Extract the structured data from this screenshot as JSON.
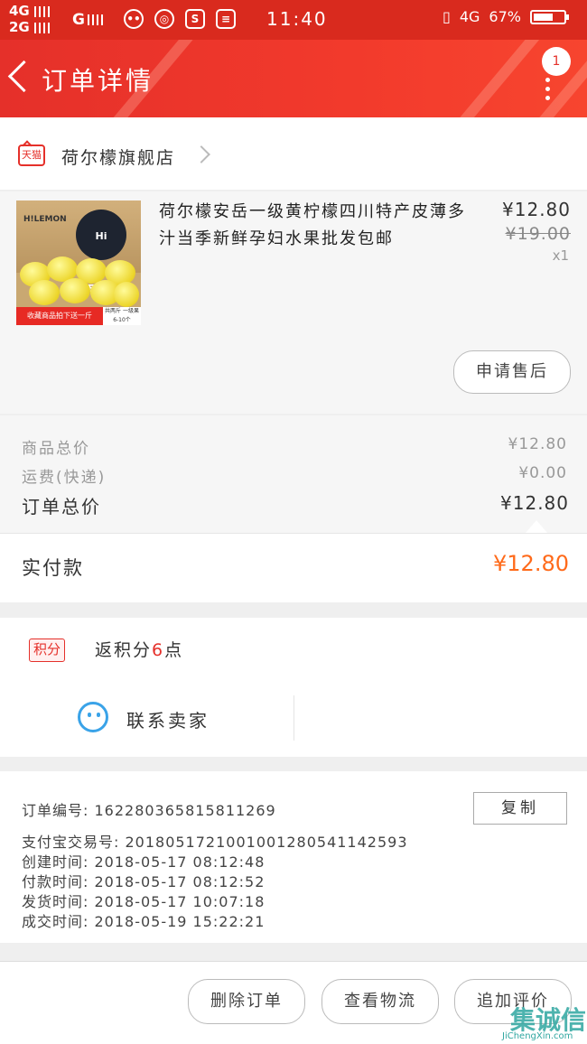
{
  "status_bar": {
    "net1": "4G",
    "net2": "2G",
    "net3": "G",
    "time": "11:40",
    "net_right": "4G",
    "battery_text": "67%",
    "battery_level": 0.67
  },
  "nav": {
    "title": "订单详情",
    "badge": "1"
  },
  "shop": {
    "tag": "天猫",
    "name": "荷尔檬旗舰店"
  },
  "product": {
    "image_brand": "H!LEMON",
    "image_badge": "Hi LEMON",
    "image_promo": "收藏商品拍下送一斤",
    "image_promo2": "共两斤 一级果6-10个",
    "title": "荷尔檬安岳一级黄柠檬四川特产皮薄多汁当季新鲜孕妇水果批发包邮",
    "price": "¥12.80",
    "original_price": "¥19.00",
    "quantity": "x1",
    "after_sale_button": "申请售后"
  },
  "totals": {
    "goods_label": "商品总价",
    "goods_value": "¥12.80",
    "shipping_label": "运费(快递)",
    "shipping_value": "¥0.00",
    "order_label": "订单总价",
    "order_value": "¥12.80",
    "paid_label": "实付款",
    "paid_value": "¥12.80"
  },
  "points": {
    "tag": "积分",
    "text_before": "返积分",
    "amount": "6",
    "text_after": "点"
  },
  "contact": {
    "label": "联系卖家"
  },
  "order_info": {
    "order_no": "订单编号:  1622803658158112​69",
    "alipay_no": "支付宝交易号:  2018051721001001280541142593",
    "created": "创建时间:  2018-05-17  08:12:48",
    "paid": "付款时间:  2018-05-17  08:12:52",
    "shipped": "发货时间:  2018-05-17  10:07:18",
    "completed": "成交时间:  2018-05-19  15:22:21",
    "copy_button": "复制"
  },
  "bottom_actions": {
    "delete": "删除订单",
    "logistics": "查看物流",
    "review": "追加评价"
  },
  "watermark": {
    "main": "集诚信",
    "sub": "JiChengXin.com"
  }
}
